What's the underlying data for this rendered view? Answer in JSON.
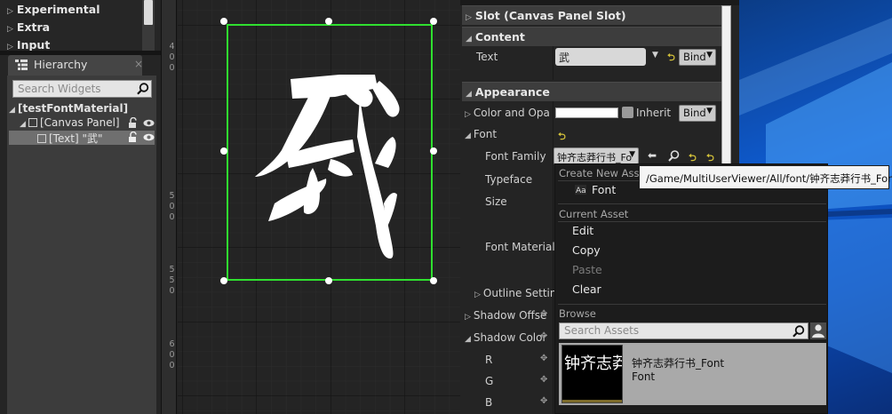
{
  "palette": {
    "categories": [
      "Experimental",
      "Extra",
      "Input"
    ]
  },
  "hierarchy": {
    "tab_label": "Hierarchy",
    "close_glyph": "×",
    "search_placeholder": "Search Widgets",
    "tree": [
      {
        "label": "[testFontMaterial]"
      },
      {
        "label": "[Canvas Panel]"
      },
      {
        "label": "[Text] \"武\""
      }
    ]
  },
  "canvas": {
    "ruler_labels": [
      "400",
      "500",
      "550",
      "600"
    ],
    "glyph_text": "武"
  },
  "details": {
    "slot_section": "Slot (Canvas Panel Slot)",
    "content_section": "Content",
    "text_label": "Text",
    "text_value": "武",
    "bind_label": "Bind",
    "appearance_section": "Appearance",
    "color_label": "Color and Opa",
    "inherit_label": "Inherit",
    "font_label": "Font",
    "font_family_label": "Font Family",
    "font_family_value": "钟齐志莽行书_Fo",
    "typeface_label": "Typeface",
    "size_label": "Size",
    "font_material_label": "Font Material",
    "outline_label": "Outline Setting",
    "shadow_offset_label": "Shadow Offse",
    "shadow_color_label": "Shadow Color",
    "channels": [
      "R",
      "G",
      "B"
    ],
    "reset_glyph": "⮌"
  },
  "menu": {
    "create_new_header": "Create New Asset",
    "font_item": "Font",
    "current_asset_header": "Current Asset",
    "edit": "Edit",
    "copy": "Copy",
    "paste": "Paste",
    "clear": "Clear",
    "browse_header": "Browse",
    "search_placeholder": "Search Assets",
    "asset_name": "钟齐志莽行书_Font",
    "asset_type": "Font",
    "asset_preview_text": "钟齐志莽"
  },
  "tooltip": {
    "path": "/Game/MultiUserViewer/All/font/钟齐志莽行书_Font"
  },
  "colors": {
    "selection_green": "#2fe02f",
    "panel": "#242424",
    "highlight": "#6f6f6f",
    "reset_yellow": "#d4c23a"
  }
}
